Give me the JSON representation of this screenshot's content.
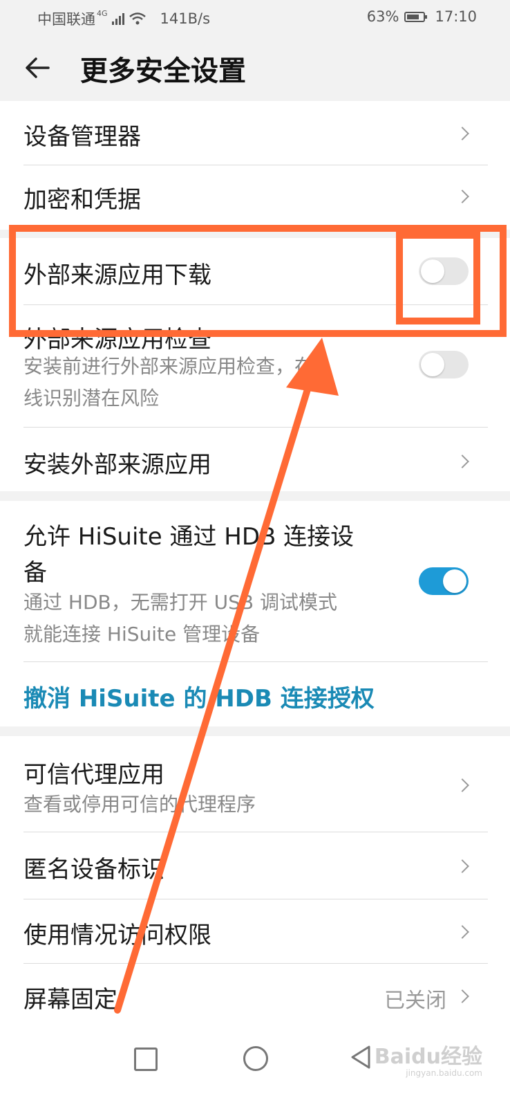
{
  "status_bar": {
    "carrier": "中国联通",
    "network_tag": "4G",
    "speed": "141B/s",
    "battery": "63%",
    "time": "17:10"
  },
  "header": {
    "title": "更多安全设置"
  },
  "group1": {
    "device_manager": "设备管理器",
    "encryption": "加密和凭据"
  },
  "group2": {
    "ext_download": {
      "title": "外部来源应用下载",
      "enabled": false
    },
    "ext_check": {
      "title": "外部来源应用检查",
      "subtitle_line1": "安装前进行外部来源应用检查，在",
      "subtitle_line2": "线识别潜在风险",
      "enabled": false
    },
    "install_ext": "安装外部来源应用"
  },
  "group3": {
    "hisuite": {
      "title_line1": "允许 HiSuite 通过 HDB 连接设",
      "title_line2": "备",
      "subtitle_line1": "通过 HDB，无需打开 USB 调试模式",
      "subtitle_line2": "就能连接 HiSuite 管理设备",
      "enabled": true
    },
    "revoke_link": "撤消 HiSuite 的 HDB 连接授权"
  },
  "group4": {
    "trust_agents": {
      "title": "可信代理应用",
      "subtitle": "查看或停用可信的代理程序"
    },
    "anon_id": "匿名设备标识",
    "usage_access": "使用情况访问权限",
    "screen_pin": {
      "title": "屏幕固定",
      "value": "已关闭"
    }
  },
  "watermark": {
    "brand": "Baidu经验",
    "url": "jingyan.baidu.com"
  },
  "colors": {
    "accent": "#1e9bd7",
    "link": "#1a8ab5",
    "annotation": "#ff6a35"
  }
}
